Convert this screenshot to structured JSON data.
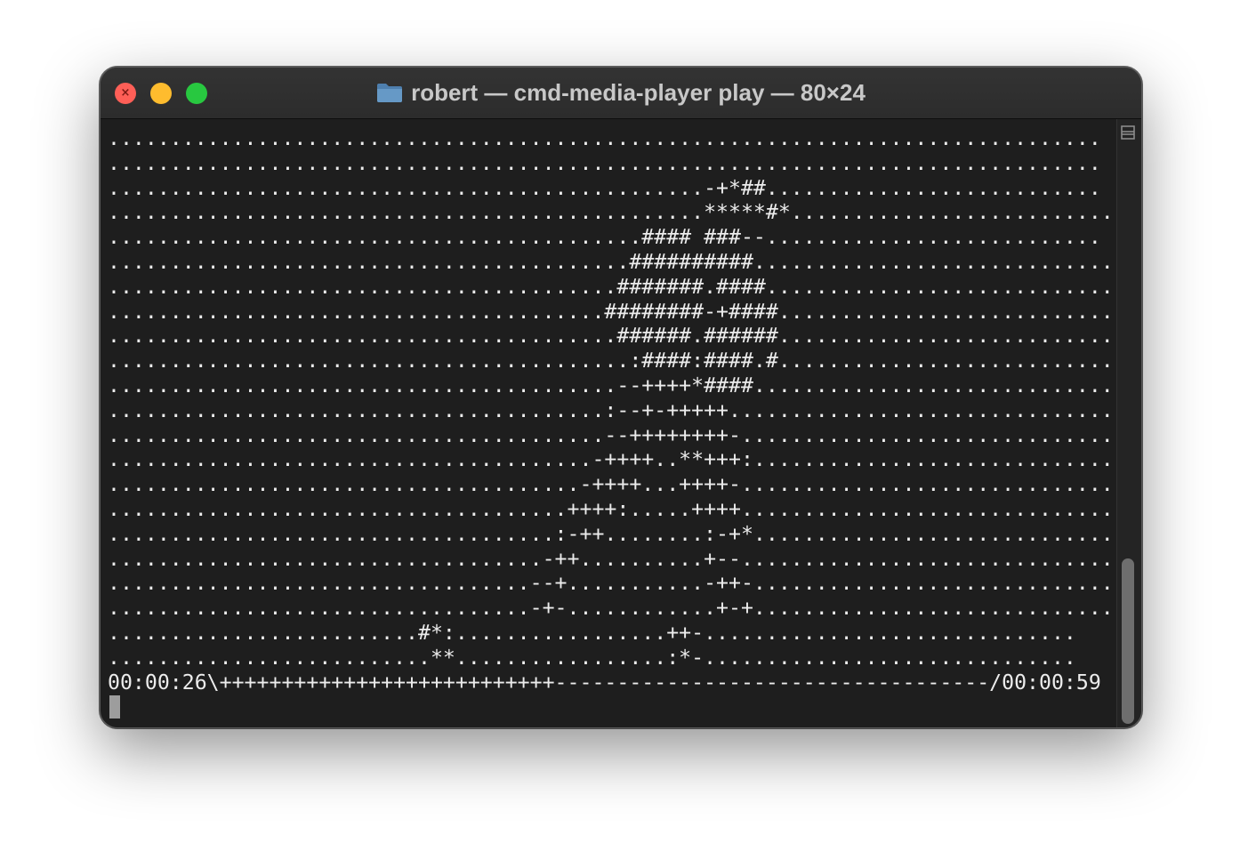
{
  "window": {
    "title": "robert — cmd-media-player play — 80×24",
    "title_icon": "folder-icon",
    "controls": {
      "close": "close-button",
      "minimize": "minimize-button",
      "zoom": "zoom-button",
      "close_glyph": "×"
    },
    "colors": {
      "close": "#ff5f57",
      "minimize": "#febc2e",
      "zoom": "#28c840",
      "background": "#1e1e1e",
      "text": "#ececec",
      "titlebar": "#2f2f2f"
    }
  },
  "terminal": {
    "lines": [
      "................................................................................",
      "................................................................................",
      "................................................-+*##...........................",
      "................................................*****#*..........................",
      "...........................................#### ###--...........................",
      "..........................................##########.............................",
      ".........................................#######.####............................",
      "........................................########-+####...........................",
      ".........................................######.######...........................",
      "..........................................:####:####.#...........................",
      ".........................................--++++*####.............................",
      "........................................:--+-+++++...............................",
      "........................................--++++++++-..............................",
      ".......................................-++++..**+++:..............................",
      "......................................-++++...++++-..............................",
      ".....................................++++:.....++++...............................",
      "....................................:-++........:-+*.............................",
      "...................................-++..........+--..............................",
      "..................................--+...........-++-.............................",
      "..................................-+-............+-+.............................",
      ".........................#*:.................++-..............................",
      "..........................**.................:*-..............................",
      "00:00:26\\+++++++++++++++++++++++++++-----------------------------------/00:00:59"
    ],
    "progress": {
      "elapsed": "00:00:26",
      "total": "00:00:59",
      "fraction": 0.44
    },
    "cursor_icon": "block-cursor"
  },
  "scrollbar": {
    "toggle_icon": "split-pane-icon",
    "thumb_fraction": 0.27
  }
}
